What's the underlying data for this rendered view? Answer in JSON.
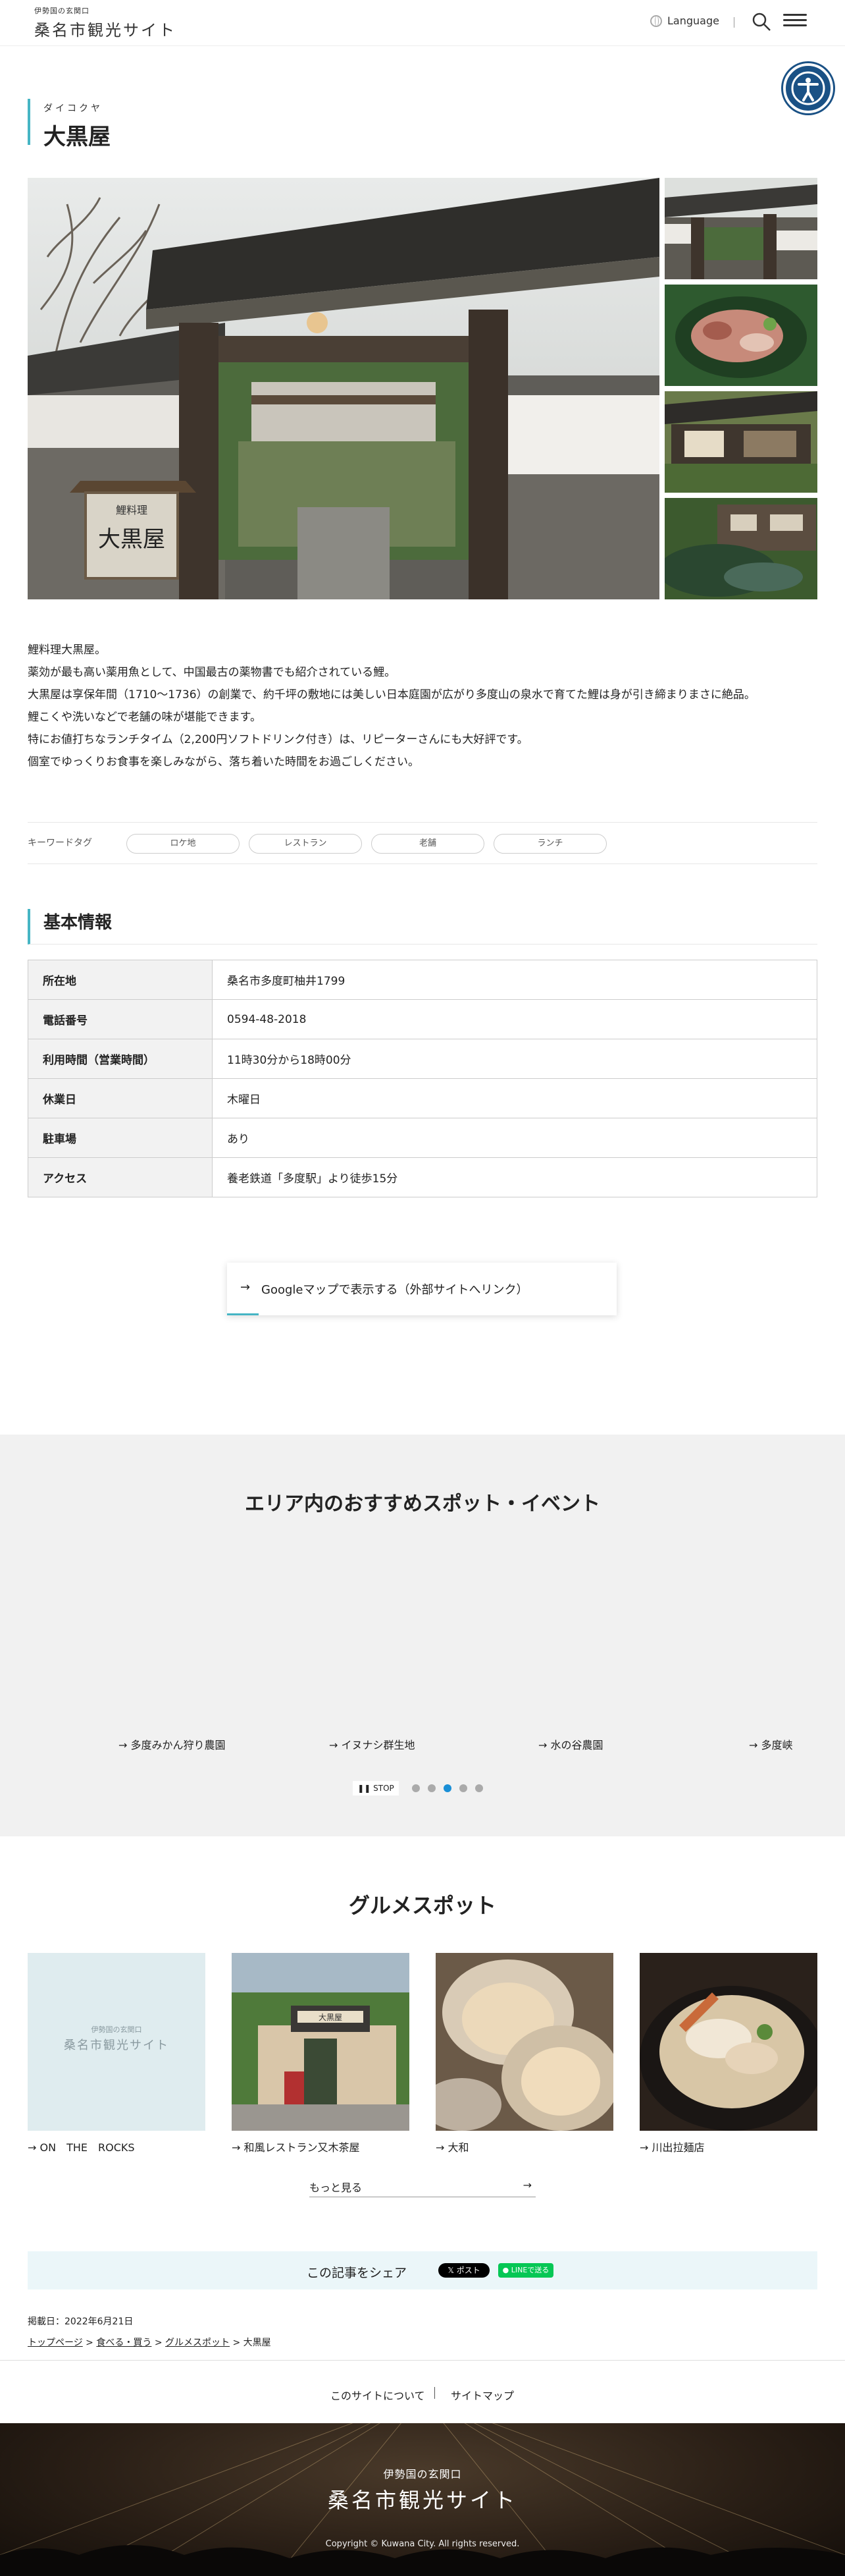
{
  "header": {
    "logo_sub": "伊勢国の玄関口",
    "logo_main": "桑名市観光サイト",
    "language_label": "Language",
    "icons": [
      "globe-icon",
      "search-icon",
      "hamburger-menu-icon",
      "accessibility-icon"
    ]
  },
  "page": {
    "ruby": "ダイコクヤ",
    "title": "大黒屋"
  },
  "gallery": {
    "sign_text": "大黒屋"
  },
  "description": [
    "鯉料理大黒屋。",
    "薬効が最も高い薬用魚として、中国最古の薬物書でも紹介されている鯉。",
    "大黒屋は享保年間（1710～1736）の創業で、約千坪の敷地には美しい日本庭園が広がり多度山の泉水で育てた鯉は身が引き締まりまさに絶品。",
    "鯉こくや洗いなどで老舗の味が堪能できます。",
    "特にお値打ちなランチタイム（2,200円ソフトドリンク付き）は、リピーターさんにも大好評です。",
    "個室でゆっくりお食事を楽しみながら、落ち着いた時間をお過ごしください。"
  ],
  "keywords": {
    "label": "キーワードタグ",
    "tags": [
      "ロケ地",
      "レストラン",
      "老舗",
      "ランチ"
    ]
  },
  "basic_info": {
    "title": "基本情報",
    "rows": [
      {
        "key": "所在地",
        "value": "桑名市多度町柚井1799"
      },
      {
        "key": "電話番号",
        "value": "0594-48-2018"
      },
      {
        "key": "利用時間（営業時間）",
        "value": "11時30分から18時00分"
      },
      {
        "key": "休業日",
        "value": "木曜日"
      },
      {
        "key": "駐車場",
        "value": "あり"
      },
      {
        "key": "アクセス",
        "value": "養老鉄道「多度駅」より徒歩15分"
      }
    ]
  },
  "map_button": "Googleマップで表示する（外部サイトへリンク）",
  "recommended": {
    "title": "エリア内のおすすめスポット・イベント",
    "items": [
      "多度みかん狩り農園",
      "イヌナシ群生地",
      "水の谷農園",
      "多度峡"
    ],
    "stop_label": "STOP",
    "slide_count": 5,
    "active_slide": 3
  },
  "gourmet": {
    "title": "グルメスポット",
    "placeholder_sub": "伊勢国の玄関口",
    "placeholder_main": "桑名市観光サイト",
    "shop_sign": "大黒屋",
    "items": [
      "ON　THE　ROCKS",
      "和風レストラン又木茶屋",
      "大和",
      "川出拉麺店"
    ],
    "more_label": "もっと見る"
  },
  "share": {
    "label": "この記事をシェア",
    "x_label": "ポスト",
    "line_label": "LINEで送る"
  },
  "published": "掲載日：2022年6月21日",
  "breadcrumb": [
    "トップページ",
    "食べる・買う",
    "グルメスポット",
    "大黒屋"
  ],
  "footer_links": [
    "このサイトについて",
    "サイトマップ"
  ],
  "footer": {
    "sub": "伊勢国の玄関口",
    "main": "桑名市観光サイト",
    "copyright": "Copyright © Kuwana City. All rights reserved."
  }
}
